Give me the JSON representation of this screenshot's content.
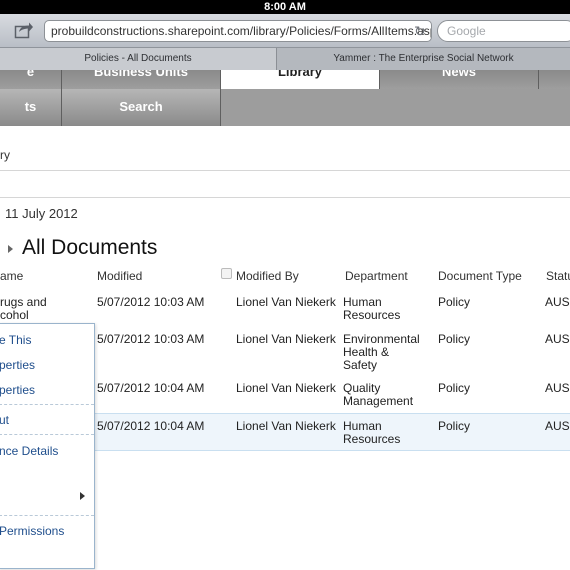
{
  "status_bar": {
    "time": "8:00 AM"
  },
  "browser": {
    "url": "probuildconstructions.sharepoint.com/library/Policies/Forms/AllItems.aspx",
    "search_placeholder": "Google",
    "tabs": [
      {
        "label": "Policies - All Documents"
      },
      {
        "label": "Yammer : The Enterprise Social Network"
      }
    ]
  },
  "nav": {
    "top_row": [
      "e",
      "Business Units",
      "Library",
      "News"
    ],
    "second_row": [
      "ts",
      "Search"
    ]
  },
  "breadcrumb": "ry",
  "modified_date": "11 July 2012",
  "view_title": "All Documents",
  "table": {
    "headers": [
      "ame",
      "Modified",
      "Modified By",
      "Department",
      "Document Type",
      "Statu"
    ],
    "rows": [
      {
        "name_line1": "rugs and",
        "name_line2": "cohol",
        "modified": "5/07/2012 10:03 AM",
        "modified_by": "Lionel Van Niekerk",
        "dept_line1": "Human",
        "dept_line2": "Resources",
        "dept_line3": "",
        "doc_type": "Policy",
        "status": "AUS"
      },
      {
        "name_line1": "",
        "name_line2": "",
        "modified": "5/07/2012 10:03 AM",
        "modified_by": "Lionel Van Niekerk",
        "dept_line1": "Environmental",
        "dept_line2": "Health &",
        "dept_line3": "Safety",
        "doc_type": "Policy",
        "status": "AUS"
      },
      {
        "name_line1": "",
        "name_line2": "",
        "modified": "5/07/2012 10:04 AM",
        "modified_by": "Lionel Van Niekerk",
        "dept_line1": "Quality",
        "dept_line2": "Management",
        "dept_line3": "",
        "doc_type": "Policy",
        "status": "AUS"
      },
      {
        "name_line1": "",
        "name_line2": "",
        "modified": "5/07/2012 10:04 AM",
        "modified_by": "Lionel Van Niekerk",
        "dept_line1": "Human",
        "dept_line2": "Resources",
        "dept_line3": "",
        "doc_type": "Policy",
        "status": "AUS"
      }
    ]
  },
  "context_menu": {
    "items": [
      "e This",
      "perties",
      "perties",
      "ut",
      "nce Details",
      "Permissions"
    ]
  },
  "colors": {
    "nav_gray": "#9b9b9b",
    "link_blue": "#1f4e8c",
    "selected_row": "#eef5fb"
  }
}
